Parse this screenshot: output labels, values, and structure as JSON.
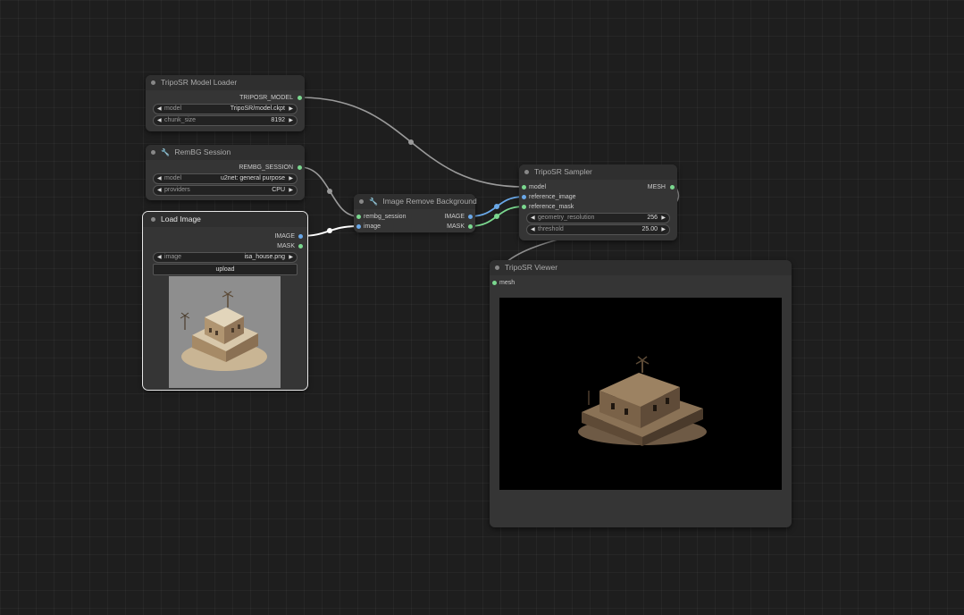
{
  "colors": {
    "background": "#1e1e1e",
    "node_body": "#353535",
    "node_title": "#2f2f2f",
    "port_green": "#7bd88f",
    "port_blue": "#6aa8e8",
    "wire_gray": "#9a9a9a",
    "wire_white": "#ffffff"
  },
  "nodes": {
    "model_loader": {
      "title": "TripoSR Model Loader",
      "output": "TRIPOSR_MODEL",
      "widgets": [
        {
          "label": "model",
          "value": "TripoSR/model.ckpt"
        },
        {
          "label": "chunk_size",
          "value": "8192"
        }
      ]
    },
    "rembg_session": {
      "title": "RemBG Session",
      "output": "REMBG_SESSION",
      "widgets": [
        {
          "label": "model",
          "value": "u2net: general purpose"
        },
        {
          "label": "providers",
          "value": "CPU"
        }
      ]
    },
    "load_image": {
      "title": "Load Image",
      "outputs": [
        "IMAGE",
        "MASK"
      ],
      "widgets": [
        {
          "label": "image",
          "value": "isa_house.png"
        }
      ],
      "upload_label": "upload"
    },
    "remove_bg": {
      "title": "Image Remove Background",
      "inputs": [
        "rembg_session",
        "image"
      ],
      "outputs": [
        "IMAGE",
        "MASK"
      ]
    },
    "sampler": {
      "title": "TripoSR Sampler",
      "inputs": [
        "model",
        "reference_image",
        "reference_mask"
      ],
      "output": "MESH",
      "widgets": [
        {
          "label": "geometry_resolution",
          "value": "256"
        },
        {
          "label": "threshold",
          "value": "25.00"
        }
      ]
    },
    "viewer": {
      "title": "TripoSR Viewer",
      "input": "mesh"
    }
  }
}
